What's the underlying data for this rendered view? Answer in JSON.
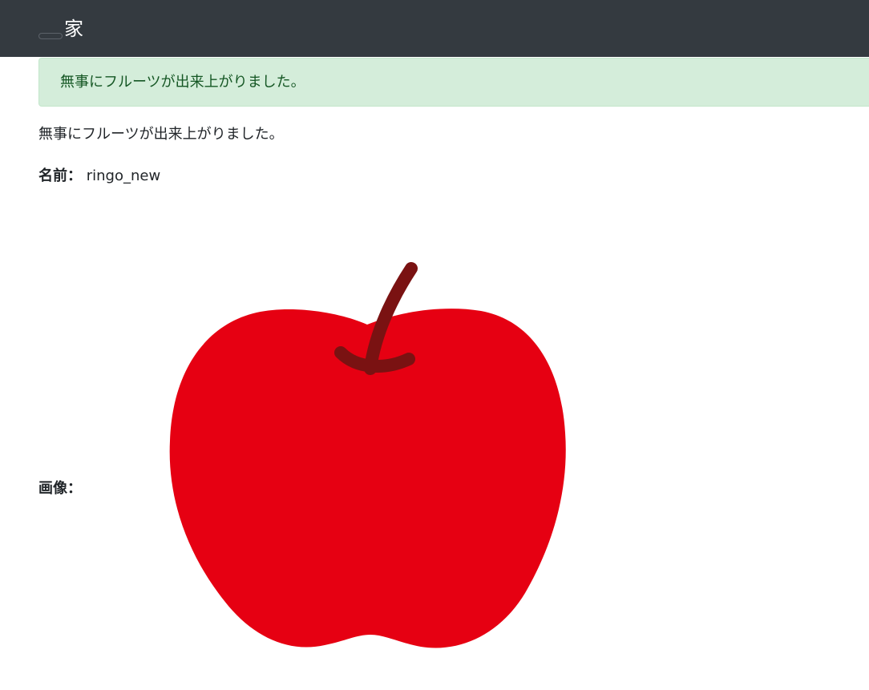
{
  "navbar": {
    "brand": "家"
  },
  "flash": {
    "message": "無事にフルーツが出来上がりました。"
  },
  "notice": "無事にフルーツが出来上がりました。",
  "fruit": {
    "name_label": "名前：",
    "name_value": "ringo_new",
    "image_label": "画像："
  },
  "image": {
    "icon": "apple-image",
    "colors": {
      "body": "#e60012",
      "stem": "#7a1212"
    }
  }
}
